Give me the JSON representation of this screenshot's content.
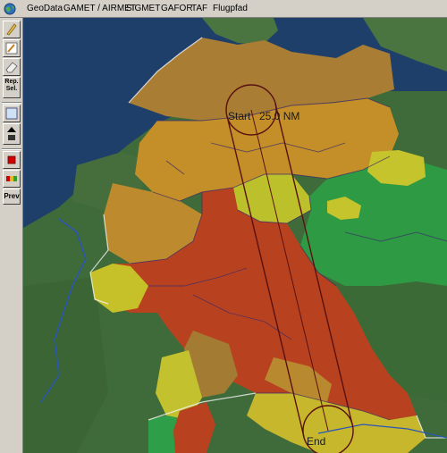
{
  "menu": {
    "items": [
      "GeoData",
      "GAMET / AIRMET",
      "SIGMET",
      "GAFOR",
      "TAF",
      "Flugpfad"
    ]
  },
  "toolbar": {
    "rep_sel_label": "Rep. Sel.",
    "prev_label": "Prev"
  },
  "route": {
    "start_label": "Start",
    "radius_label": "25.0 NM",
    "end_label": "End"
  },
  "colors": {
    "water": "#1f3f6b",
    "land": "#3f6b3a",
    "gafor_brown": "#a97d34",
    "gafor_orange": "#c48f28",
    "gafor_red": "#b8421f",
    "gafor_yellow": "#c7c32c",
    "gafor_green": "#2e9a44",
    "route_line": "#5a1010"
  }
}
